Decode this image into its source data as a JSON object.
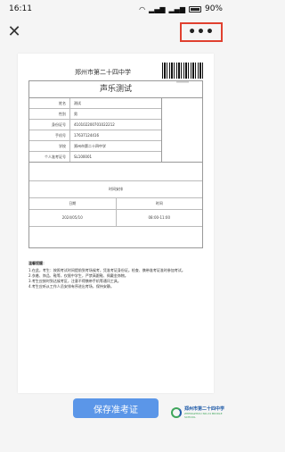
{
  "statusbar": {
    "time": "16:11",
    "battery": "90%"
  },
  "navbar": {
    "close_glyph": "✕",
    "more_glyph": "•••"
  },
  "ticket": {
    "school_name": "郑州市第二十四中学",
    "barcode_number": "||||||||||||||",
    "title": "声乐测试",
    "fields": [
      {
        "label": "姓名",
        "value": "测试"
      },
      {
        "label": "性别",
        "value": "男"
      },
      {
        "label": "身份证号",
        "value": "410102200701022212"
      },
      {
        "label": "手机号",
        "value": "17637124416"
      },
      {
        "label": "学校",
        "value": "郑州市第二十四中学"
      },
      {
        "label": "个人准考证号",
        "value": "SL100001"
      }
    ],
    "time_header": "时间安排",
    "time_columns": [
      "日期",
      "时间"
    ],
    "time_values": [
      "2024/05/10",
      "08:00-11:00"
    ]
  },
  "notice": {
    "title": "温馨提醒：",
    "lines": [
      "1.在此，考生：按照考试时间提前到考场候考，凭准考证身份证。检查、携带准考证准时参加考试。",
      "2.衣着、饰品、鞋等，仅限中学生，严禁高跟鞋、佩戴金饰物。",
      "3.考生应按时到达候考区，注意不得携带手机等通讯工具。",
      "4.考生应听从工作人员安排有序进出考场，保持安静。"
    ]
  },
  "actions": {
    "save_label": "保存准考证"
  },
  "logo": {
    "name": "郑州市第二十四中学",
    "tagline": "ZHENGZHOU NO.24 MIDDLE SCHOOL"
  },
  "colors": {
    "button": "#5b96e8",
    "highlight": "#e0402f",
    "logo_blue": "#1e5aa8",
    "logo_green": "#3ea55a"
  }
}
